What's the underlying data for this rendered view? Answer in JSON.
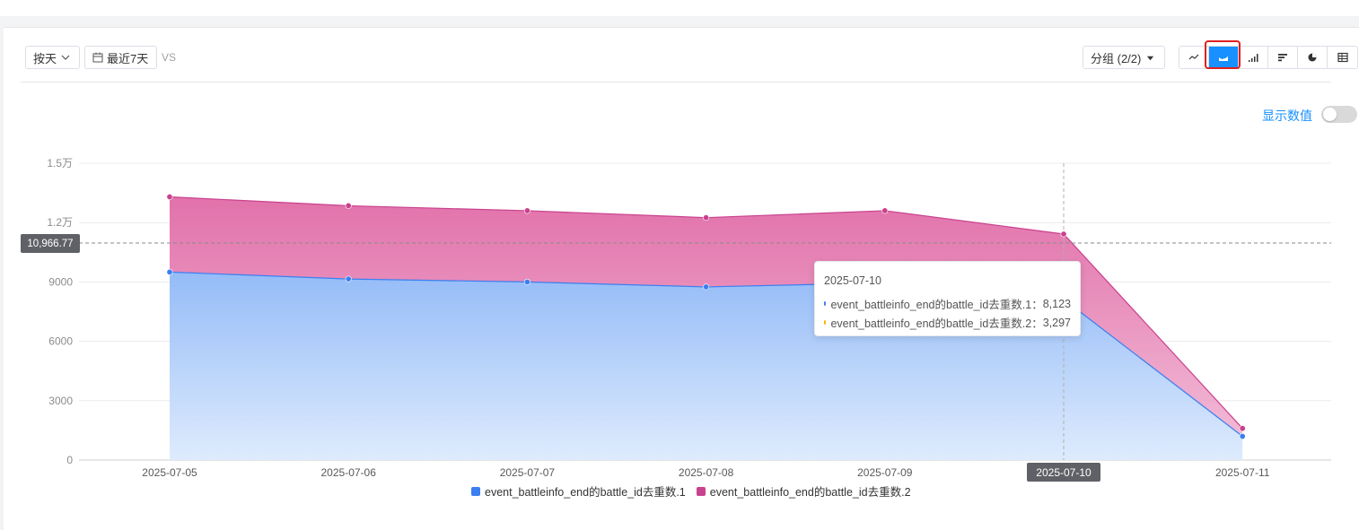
{
  "toolbar": {
    "granularity_label": "按天",
    "date_range_label": "最近7天",
    "vs_label": "VS",
    "group_label": "分组 (2/2)"
  },
  "view_switcher": {
    "options": [
      "line-chart-icon",
      "area-chart-icon",
      "bar-chart-icon",
      "horizontal-bar-icon",
      "pie-chart-icon",
      "table-icon"
    ],
    "active": "area-chart-icon"
  },
  "show_values": {
    "label": "显示数值",
    "enabled": false
  },
  "colors": {
    "series1": "#3b7ff0",
    "series2": "#c9428d",
    "tooltip_series2_dot": "#f5b800",
    "active": "#1890ff",
    "highlight": "#e02020"
  },
  "chart_data": {
    "type": "area",
    "stacked": true,
    "categories": [
      "2025-07-05",
      "2025-07-06",
      "2025-07-07",
      "2025-07-08",
      "2025-07-09",
      "2025-07-10",
      "2025-07-11"
    ],
    "series": [
      {
        "name": "event_battleinfo_end的battle_id去重数.1",
        "values": [
          9500,
          9150,
          9000,
          8750,
          8950,
          8123,
          1200
        ]
      },
      {
        "name": "event_battleinfo_end的battle_id去重数.2",
        "values": [
          3800,
          3700,
          3600,
          3500,
          3650,
          3297,
          400
        ]
      }
    ],
    "y_ticks": [
      "0",
      "3000",
      "6000",
      "9000",
      "1.2万",
      "1.5万"
    ],
    "ylim": [
      0,
      15000
    ],
    "grid": true,
    "legend_position": "bottom",
    "crosshair": {
      "category": "2025-07-10",
      "y_value": 10966.77,
      "y_label": "10,966.77"
    }
  },
  "tooltip": {
    "date": "2025-07-10",
    "rows": [
      {
        "name": "event_battleinfo_end的battle_id去重数.1",
        "value": "8,123"
      },
      {
        "name": "event_battleinfo_end的battle_id去重数.2",
        "value": "3,297"
      }
    ]
  }
}
